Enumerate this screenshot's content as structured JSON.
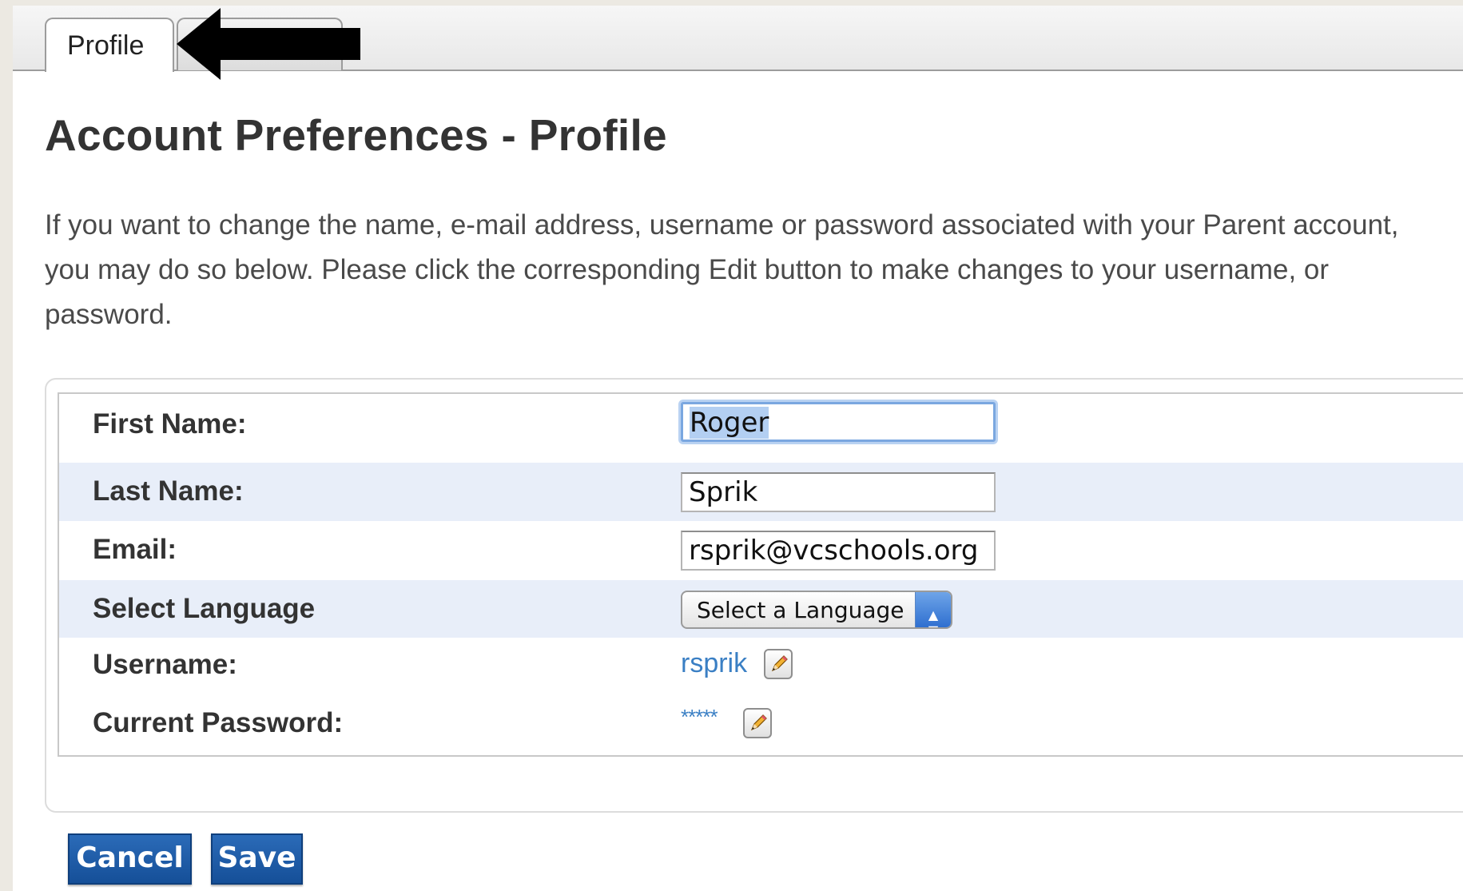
{
  "tabs": [
    {
      "label": "Profile",
      "active": true
    },
    {
      "label": "",
      "active": false
    }
  ],
  "page_title": "Account Preferences - Profile",
  "intro_text": "If you want to change the name, e-mail address, username or password associated with your Parent account, you may do so below. Please click the corresponding Edit button to make changes to your username, or password.",
  "form": {
    "first_name": {
      "label": "First Name:",
      "value": "Roger"
    },
    "last_name": {
      "label": "Last Name:",
      "value": "Sprik"
    },
    "email": {
      "label": "Email:",
      "value": "rsprik@vcschools.org"
    },
    "language": {
      "label": "Select Language",
      "selected": "Select a Language"
    },
    "username": {
      "label": "Username:",
      "value": "rsprik"
    },
    "password": {
      "label": "Current Password:",
      "value": "*****"
    }
  },
  "buttons": {
    "cancel_label": "Cancel",
    "save_label": "Save"
  },
  "icons": {
    "edit": "pencil-icon",
    "annotation": "arrow-left-icon",
    "select_cap": "up-down-arrows-icon"
  },
  "colors": {
    "button_blue": "#1e5ba8",
    "link_blue": "#3a7fc4",
    "row_alt": "#e8eef9",
    "focus_ring": "#7aa7e0"
  }
}
